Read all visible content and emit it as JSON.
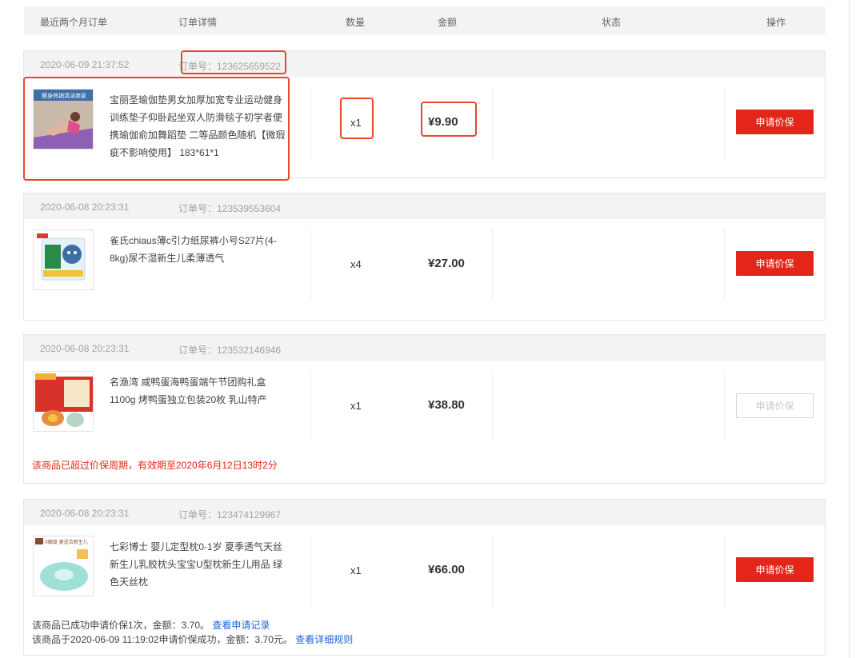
{
  "header": {
    "col_period": "最近两个月订单",
    "col_detail": "订单详情",
    "col_qty": "数量",
    "col_amount": "金额",
    "col_status": "状态",
    "col_action": "操作"
  },
  "orders": [
    {
      "date": "2020-06-09 21:37:52",
      "order_no": "订单号：123625659522",
      "product": "宝丽圣瑜伽垫男女加厚加宽专业运动健身训练垫子仰卧起坐双人防滑毯子初学者便携瑜伽俞加舞蹈垫 二等品颜色随机【微瑕疵不影响使用】 183*61*1",
      "thumb_text": "瘦身热销清洁商家",
      "qty": "x1",
      "amount": "¥9.90",
      "action": "申请价保"
    },
    {
      "date": "2020-06-08 20:23:31",
      "order_no": "订单号：123539553604",
      "product": "雀氏chiaus薄c引力纸尿裤小号S27片(4-8kg)尿不湿新生儿柔薄透气",
      "qty": "x4",
      "amount": "¥27.00",
      "action": "申请价保"
    },
    {
      "date": "2020-06-08 20:23:31",
      "order_no": "订单号：123532146946",
      "product": "名渔湾 咸鸭蛋海鸭蛋端午节团购礼盒1100g 烤鸭蛋独立包装20枚 乳山特产",
      "qty": "x1",
      "amount": "¥38.80",
      "action": "申请价保",
      "note": "该商品已超过价保周期，有效期至2020年6月12日13时2分"
    },
    {
      "date": "2020-06-08 20:23:31",
      "order_no": "订单号：123474129967",
      "product": "七彩博士 婴儿定型枕0-1岁 夏季透气天丝新生儿乳胶枕头宝宝U型枕新生儿用品 绿色天丝枕",
      "thumb_text": "0触度 更适合新生儿",
      "qty": "x1",
      "amount": "¥66.00",
      "action": "申请价保",
      "note1": "该商品已成功申请价保1次，金额：3.70。",
      "note1_link": "查看申请记录",
      "note2": "该商品于2020-06-09 11:19:02申请价保成功，金额：3.70元。",
      "note2_link": "查看详细规则"
    }
  ],
  "colors": {
    "accent_red": "#e4261a",
    "highlight": "#e8462a",
    "link": "#1a66d6"
  }
}
